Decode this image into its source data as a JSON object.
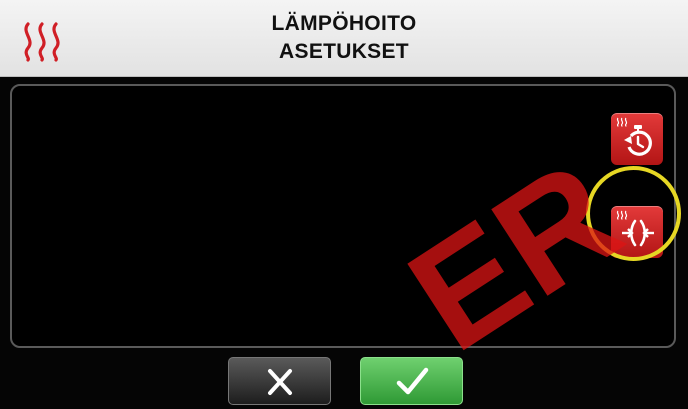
{
  "header": {
    "title_line1": "LÄMPÖHOITO",
    "title_line2": "ASETUKSET",
    "icon": "heat-waves-icon"
  },
  "side_buttons": [
    {
      "name": "heat-timer",
      "icon": "stopwatch-icon"
    },
    {
      "name": "heat-press",
      "icon": "compress-arrows-icon",
      "highlighted": true
    }
  ],
  "footer": {
    "cancel_icon": "close-icon",
    "confirm_icon": "checkmark-icon"
  },
  "watermark": {
    "text": "ER"
  },
  "colors": {
    "accent_red": "#c8202a",
    "confirm_green": "#3db34a",
    "highlight_yellow": "#e6d724",
    "header_bg": "#ececec"
  }
}
